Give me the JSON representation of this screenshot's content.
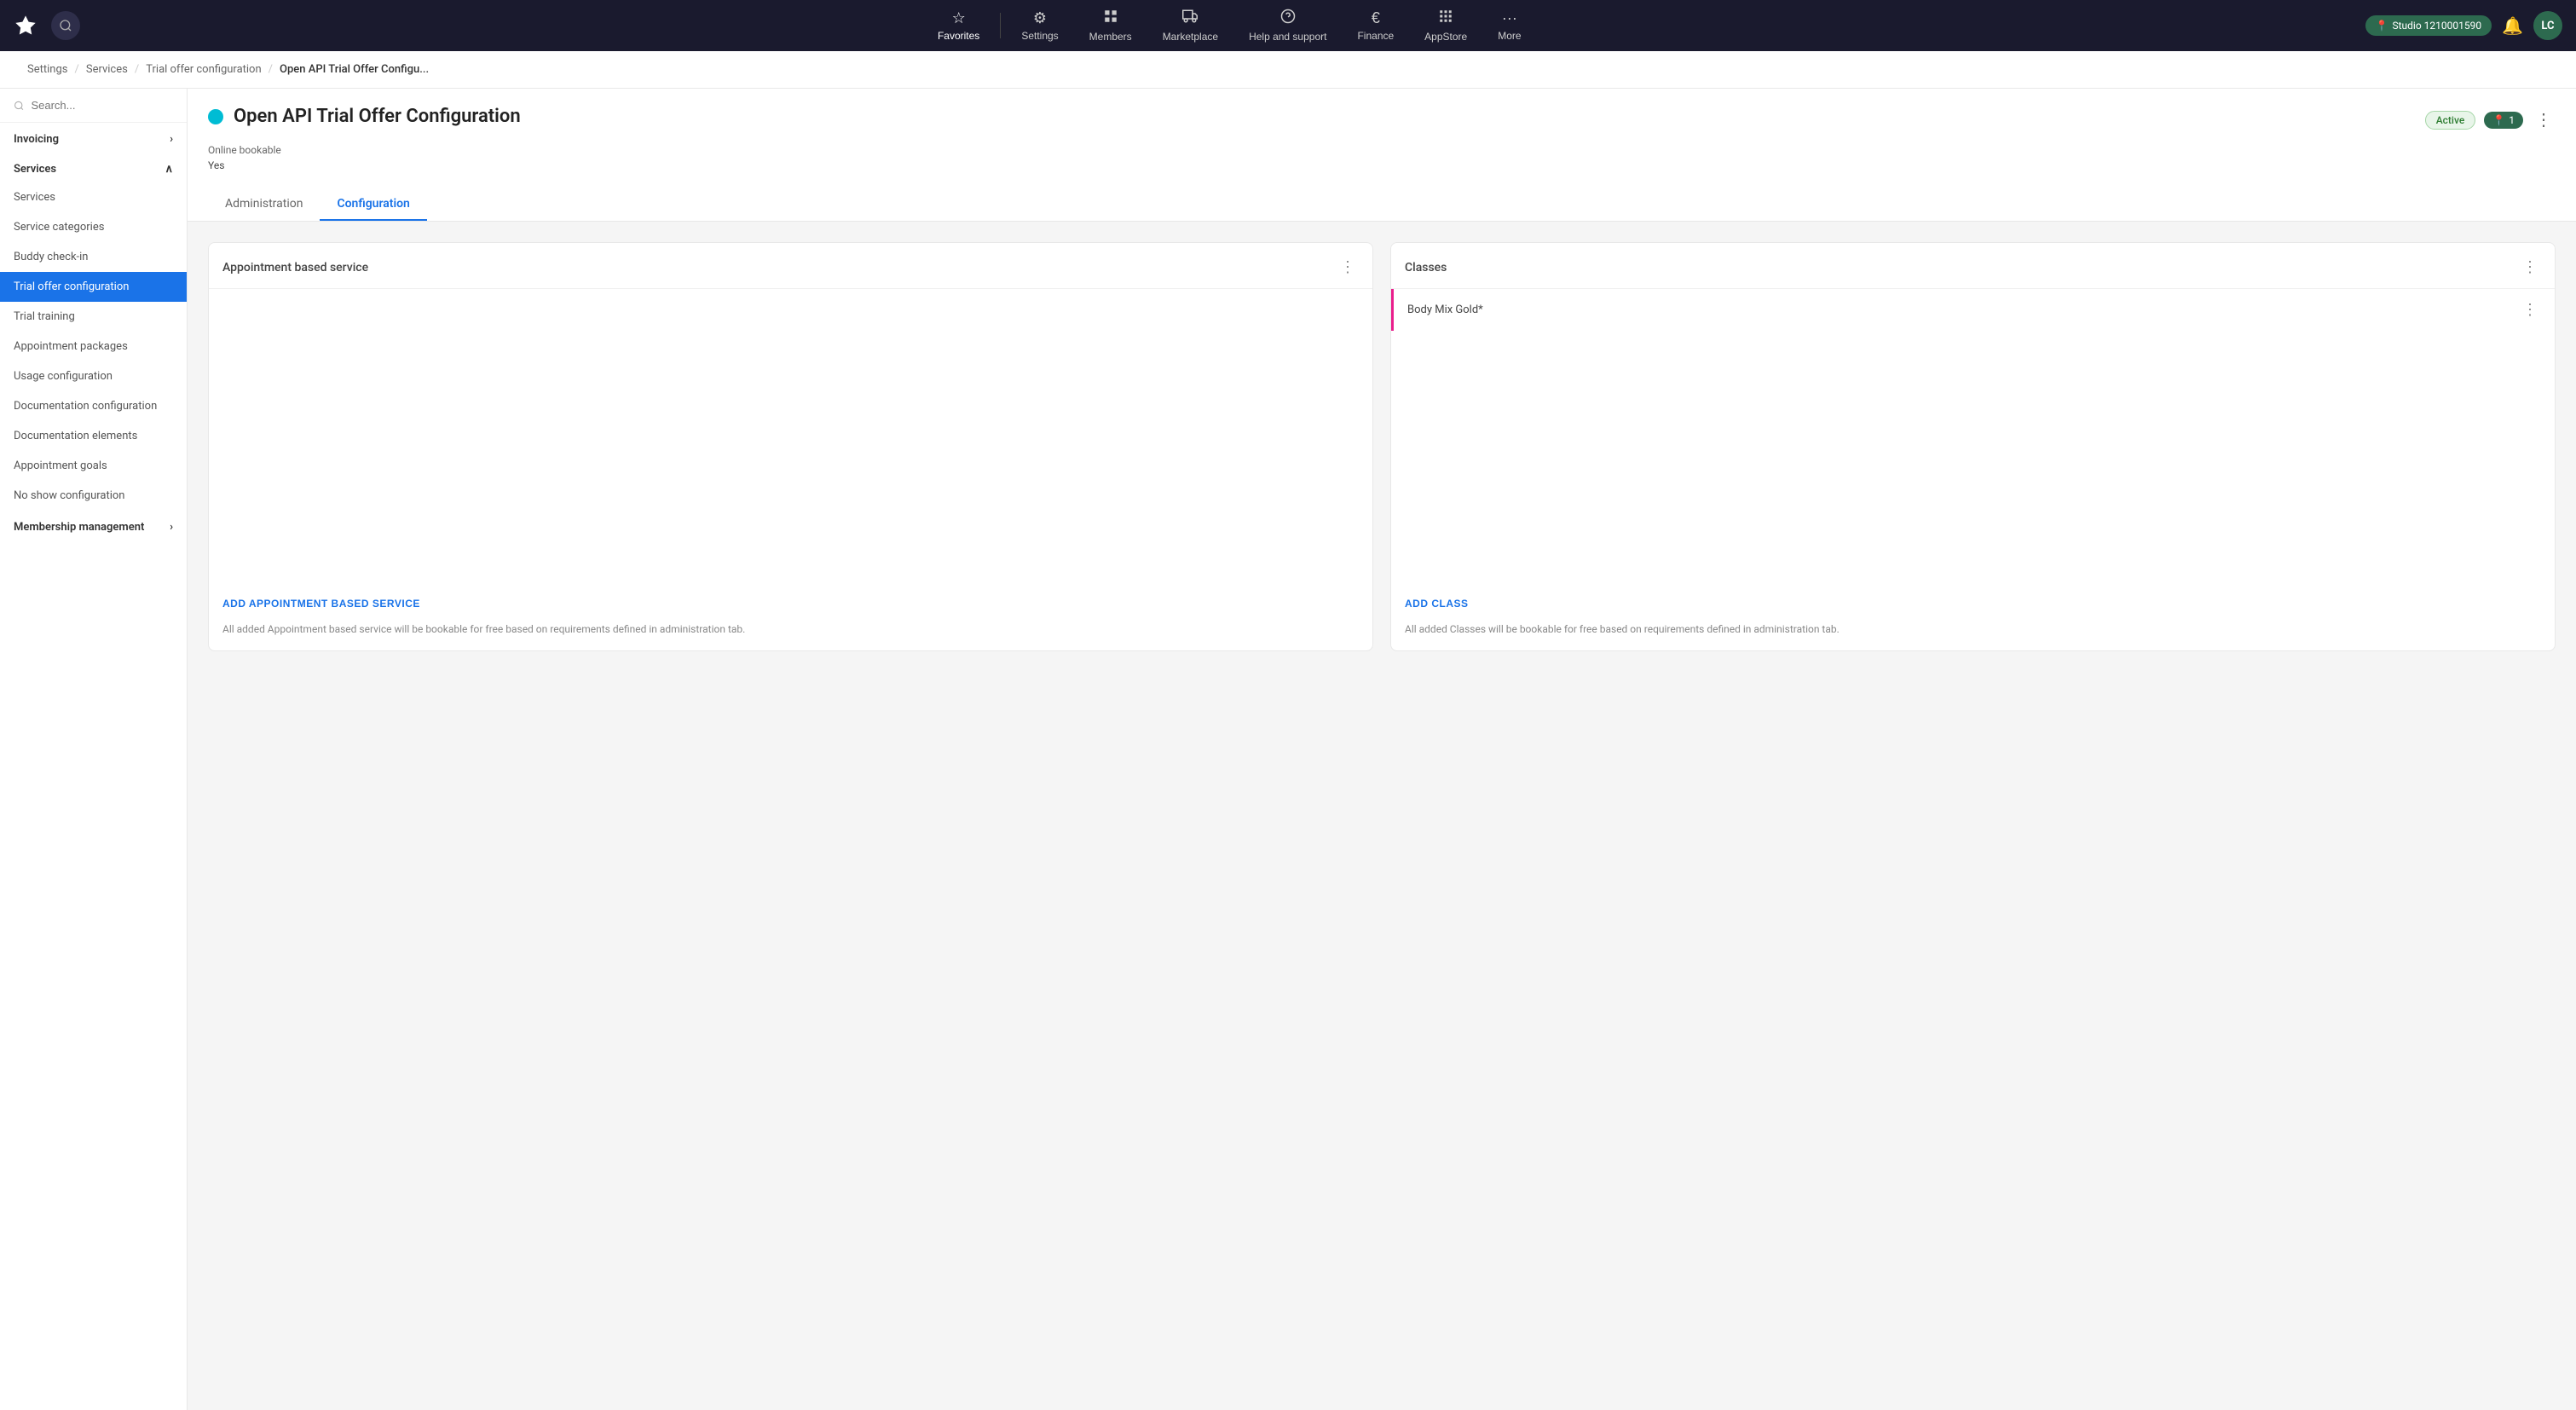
{
  "topNav": {
    "logo": "★",
    "navItems": [
      {
        "id": "favorites",
        "icon": "☆",
        "label": "Favorites",
        "active": true
      },
      {
        "id": "settings",
        "icon": "⚙",
        "label": "Settings"
      },
      {
        "id": "members",
        "icon": "▦",
        "label": "Members"
      },
      {
        "id": "marketplace",
        "icon": "▦",
        "label": "Marketplace"
      },
      {
        "id": "help",
        "icon": "?",
        "label": "Help and support"
      },
      {
        "id": "finance",
        "icon": "€",
        "label": "Finance"
      },
      {
        "id": "appstore",
        "icon": "▦",
        "label": "AppStore"
      },
      {
        "id": "more",
        "icon": "...",
        "label": "More"
      }
    ],
    "studioBadge": "Studio 1210001590",
    "avatarInitials": "LC"
  },
  "breadcrumb": {
    "items": [
      {
        "id": "settings",
        "label": "Settings"
      },
      {
        "id": "services",
        "label": "Services"
      },
      {
        "id": "trial-offer",
        "label": "Trial offer configuration"
      },
      {
        "id": "open-api",
        "label": "Open API Trial Offer Configu...",
        "active": true
      }
    ]
  },
  "sidebar": {
    "searchPlaceholder": "Search...",
    "sections": [
      {
        "id": "invoicing",
        "label": "Invoicing",
        "collapsed": true
      },
      {
        "id": "services",
        "label": "Services",
        "collapsed": false,
        "items": [
          {
            "id": "services",
            "label": "Services"
          },
          {
            "id": "service-categories",
            "label": "Service categories"
          },
          {
            "id": "buddy-checkin",
            "label": "Buddy check-in"
          },
          {
            "id": "trial-offer-config",
            "label": "Trial offer configuration",
            "active": true
          },
          {
            "id": "trial-training",
            "label": "Trial training"
          },
          {
            "id": "appointment-packages",
            "label": "Appointment packages"
          },
          {
            "id": "usage-config",
            "label": "Usage configuration"
          },
          {
            "id": "documentation-config",
            "label": "Documentation configuration"
          },
          {
            "id": "documentation-elements",
            "label": "Documentation elements"
          },
          {
            "id": "appointment-goals",
            "label": "Appointment goals"
          },
          {
            "id": "no-show-config",
            "label": "No show configuration"
          }
        ]
      },
      {
        "id": "membership-management",
        "label": "Membership management",
        "collapsed": true
      }
    ]
  },
  "pageHeader": {
    "statusDotColor": "#00bcd4",
    "title": "Open API Trial Offer Configuration",
    "statusBadge": "Active",
    "countBadge": "1",
    "countBadgeIcon": "📍",
    "onlineBookableLabel": "Online bookable",
    "onlineBookableValue": "Yes"
  },
  "tabs": [
    {
      "id": "administration",
      "label": "Administration",
      "active": false
    },
    {
      "id": "configuration",
      "label": "Configuration",
      "active": true
    }
  ],
  "cards": [
    {
      "id": "appointment-based-service",
      "title": "Appointment based service",
      "items": [],
      "addButtonLabel": "ADD APPOINTMENT BASED SERVICE",
      "addDescription": "All added Appointment based service will be bookable for free based on requirements defined in administration tab."
    },
    {
      "id": "classes",
      "title": "Classes",
      "items": [
        {
          "id": "body-mix-gold",
          "label": "Body Mix Gold*"
        }
      ],
      "addButtonLabel": "ADD CLASS",
      "addDescription": "All added Classes will be bookable for free based on requirements defined in administration tab."
    }
  ]
}
